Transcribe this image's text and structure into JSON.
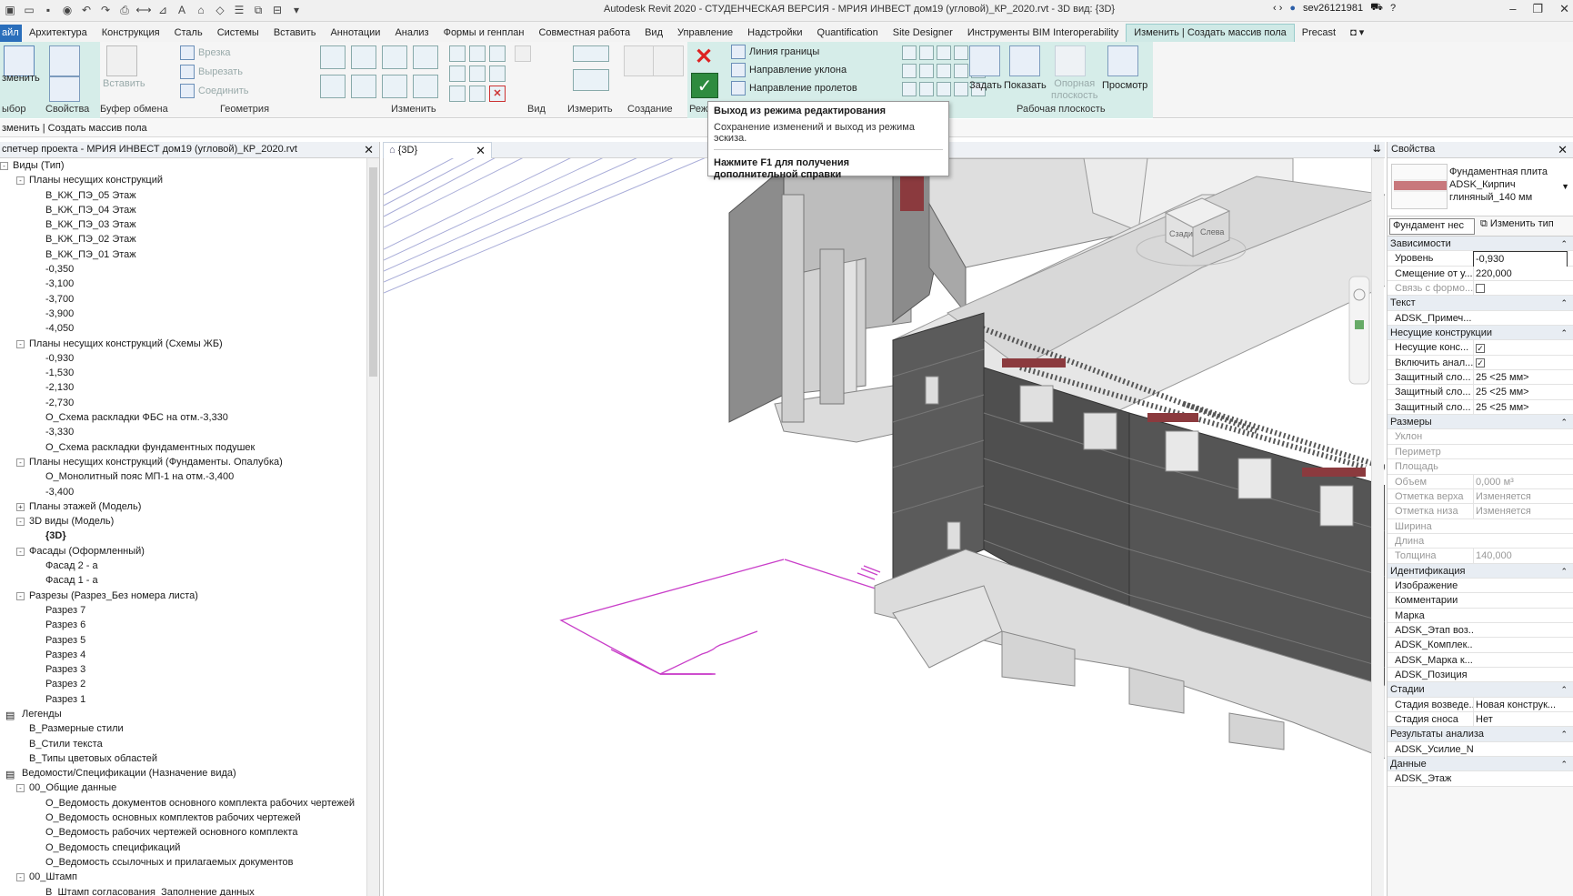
{
  "window": {
    "title": "Autodesk Revit 2020 - СТУДЕНЧЕСКАЯ ВЕРСИЯ - МРИЯ ИНВЕСТ дом19 (угловой)_КР_2020.rvt - 3D вид: {3D}",
    "user": "sev26121981"
  },
  "tabs": [
    "айл",
    "Архитектура",
    "Конструкция",
    "Сталь",
    "Системы",
    "Вставить",
    "Аннотации",
    "Анализ",
    "Формы и генплан",
    "Совместная работа",
    "Вид",
    "Управление",
    "Надстройки",
    "Quantification",
    "Site Designer",
    "Инструменты BIM Interoperability",
    "Изменить | Создать массив пола",
    "Precast"
  ],
  "ribbon": {
    "modify": "зменить",
    "select": "ыбор",
    "properties": "Свойства",
    "clipboard": "Буфер обмена",
    "paste": "Вставить",
    "cut_insert": "Врезка",
    "cut": "Вырезать",
    "join": "Соединить",
    "geometry": "Геометрия",
    "modify_panel": "Изменить",
    "view": "Вид",
    "measure": "Измерить",
    "create": "Создание",
    "mode": "Реж",
    "boundary_line": "Линия границы",
    "slope_arrow": "Направление уклона",
    "span_direction": "Направление пролетов",
    "set": "Задать",
    "show": "Показать",
    "ref_plane": "Опорная\nплоскость",
    "viewer": "Просмотр",
    "work_plane": "Рабочая плоскость"
  },
  "options_bar": "зменить | Создать массив пола",
  "tooltip": {
    "title": "Выход из режима редактирования",
    "desc": "Сохранение изменений и выход из режима эскиза.",
    "help": "Нажмите F1 для получения\nдополнительной справки"
  },
  "project_browser": {
    "title": "спетчер проекта - МРИЯ ИНВЕСТ дом19 (угловой)_КР_2020.rvt",
    "nodes": [
      {
        "t": "Виды (Тип)",
        "l": 0,
        "tog": "-"
      },
      {
        "t": "Планы несущих конструкций",
        "l": 1,
        "tog": "-"
      },
      {
        "t": "В_КЖ_ПЭ_05 Этаж",
        "l": 2
      },
      {
        "t": "В_КЖ_ПЭ_04 Этаж",
        "l": 2
      },
      {
        "t": "В_КЖ_ПЭ_03 Этаж",
        "l": 2
      },
      {
        "t": "В_КЖ_ПЭ_02 Этаж",
        "l": 2
      },
      {
        "t": "В_КЖ_ПЭ_01 Этаж",
        "l": 2
      },
      {
        "t": "-0,350",
        "l": 2
      },
      {
        "t": "-3,100",
        "l": 2
      },
      {
        "t": "-3,700",
        "l": 2
      },
      {
        "t": "-3,900",
        "l": 2
      },
      {
        "t": "-4,050",
        "l": 2
      },
      {
        "t": "Планы несущих конструкций (Схемы ЖБ)",
        "l": 1,
        "tog": "-"
      },
      {
        "t": "-0,930",
        "l": 2
      },
      {
        "t": "-1,530",
        "l": 2
      },
      {
        "t": "-2,130",
        "l": 2
      },
      {
        "t": "-2,730",
        "l": 2
      },
      {
        "t": "О_Схема раскладки ФБС на отм.-3,330",
        "l": 2
      },
      {
        "t": "-3,330",
        "l": 2
      },
      {
        "t": "О_Схема раскладки фундаментных подушек",
        "l": 2
      },
      {
        "t": "Планы несущих конструкций (Фундаменты. Опалубка)",
        "l": 1,
        "tog": "-"
      },
      {
        "t": "О_Монолитный пояс МП-1 на отм.-3,400",
        "l": 2
      },
      {
        "t": "-3,400",
        "l": 2
      },
      {
        "t": "Планы этажей (Модель)",
        "l": 1,
        "tog": "+"
      },
      {
        "t": "3D виды (Модель)",
        "l": 1,
        "tog": "-"
      },
      {
        "t": "{3D}",
        "l": 2,
        "bold": true
      },
      {
        "t": "Фасады (Оформленный)",
        "l": 1,
        "tog": "-"
      },
      {
        "t": "Фасад 2 - а",
        "l": 2
      },
      {
        "t": "Фасад 1 - а",
        "l": 2
      },
      {
        "t": "Разрезы (Разрез_Без номера листа)",
        "l": 1,
        "tog": "-"
      },
      {
        "t": "Разрез 7",
        "l": 2
      },
      {
        "t": "Разрез 6",
        "l": 2
      },
      {
        "t": "Разрез 5",
        "l": 2
      },
      {
        "t": "Разрез 4",
        "l": 2
      },
      {
        "t": "Разрез 3",
        "l": 2
      },
      {
        "t": "Разрез 2",
        "l": 2
      },
      {
        "t": "Разрез 1",
        "l": 2
      },
      {
        "t": "Легенды",
        "l": 0,
        "icon": true
      },
      {
        "t": "В_Размерные стили",
        "l": 1
      },
      {
        "t": "В_Стили текста",
        "l": 1
      },
      {
        "t": "В_Типы цветовых областей",
        "l": 1
      },
      {
        "t": "Ведомости/Спецификации (Назначение вида)",
        "l": 0,
        "icon": true
      },
      {
        "t": "00_Общие данные",
        "l": 1,
        "tog": "-"
      },
      {
        "t": "О_Ведомость документов основного комплекта рабочих чертежей",
        "l": 2
      },
      {
        "t": "О_Ведомость основных комплектов рабочих чертежей",
        "l": 2
      },
      {
        "t": "О_Ведомость рабочих чертежей основного комплекта",
        "l": 2
      },
      {
        "t": "О_Ведомость спецификаций",
        "l": 2
      },
      {
        "t": "О_Ведомость ссылочных и прилагаемых документов",
        "l": 2
      },
      {
        "t": "00_Штамп",
        "l": 1,
        "tog": "-"
      },
      {
        "t": "В_Штамп согласования_Заполнение данных",
        "l": 2
      }
    ]
  },
  "view_tab": "{3D}",
  "properties": {
    "title": "Свойства",
    "type_name": "Фундаментная плита\nADSK_Кирпич\nглиняный_140 мм",
    "filter": "Фундамент нес",
    "edit_type": "Изменить тип",
    "rows": [
      {
        "g": "Зависимости"
      },
      {
        "n": "Уровень",
        "v": "-0,930",
        "edit": true
      },
      {
        "n": "Смещение от у...",
        "v": "220,000"
      },
      {
        "n": "Связь с формо...",
        "v": "",
        "cb": "",
        "grey": true
      },
      {
        "g": "Текст"
      },
      {
        "n": "ADSK_Примеч...",
        "v": ""
      },
      {
        "g": "Несущие конструкции"
      },
      {
        "n": "Несущие конс...",
        "v": "",
        "cb": "✓"
      },
      {
        "n": "Включить анал...",
        "v": "",
        "cb": "✓"
      },
      {
        "n": "Защитный сло...",
        "v": "25 <25 мм>"
      },
      {
        "n": "Защитный сло...",
        "v": "25 <25 мм>"
      },
      {
        "n": "Защитный сло...",
        "v": "25 <25 мм>"
      },
      {
        "g": "Размеры"
      },
      {
        "n": "Уклон",
        "v": "",
        "grey": true
      },
      {
        "n": "Периметр",
        "v": "",
        "grey": true
      },
      {
        "n": "Площадь",
        "v": "",
        "grey": true
      },
      {
        "n": "Объем",
        "v": "0,000 м³",
        "grey": true
      },
      {
        "n": "Отметка верха",
        "v": "Изменяется",
        "grey": true
      },
      {
        "n": "Отметка низа",
        "v": "Изменяется",
        "grey": true
      },
      {
        "n": "Ширина",
        "v": "",
        "grey": true
      },
      {
        "n": "Длина",
        "v": "",
        "grey": true
      },
      {
        "n": "Толщина",
        "v": "140,000",
        "grey": true
      },
      {
        "g": "Идентификация"
      },
      {
        "n": "Изображение",
        "v": ""
      },
      {
        "n": "Комментарии",
        "v": ""
      },
      {
        "n": "Марка",
        "v": ""
      },
      {
        "n": "ADSK_Этап воз...",
        "v": ""
      },
      {
        "n": "ADSK_Комплек...",
        "v": ""
      },
      {
        "n": "ADSK_Марка к...",
        "v": ""
      },
      {
        "n": "ADSK_Позиция",
        "v": ""
      },
      {
        "g": "Стадии"
      },
      {
        "n": "Стадия возведе...",
        "v": "Новая конструк..."
      },
      {
        "n": "Стадия сноса",
        "v": "Нет"
      },
      {
        "g": "Результаты анализа"
      },
      {
        "n": "ADSK_Усилие_N",
        "v": ""
      },
      {
        "g": "Данные"
      },
      {
        "n": "ADSK_Этаж",
        "v": ""
      }
    ]
  },
  "viewcube": {
    "left": "Слева",
    "front": "Сзади"
  },
  "colors": {
    "ribbon_context": "#d6ede9",
    "sketch": "#c93fc9",
    "brick": "#5a5a5a",
    "lintel": "#8b3a3e"
  }
}
